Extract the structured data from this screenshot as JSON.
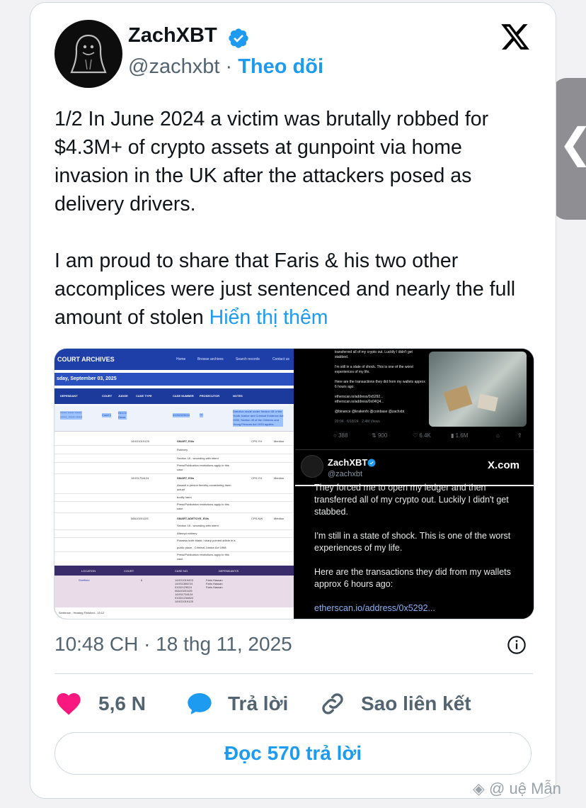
{
  "author": {
    "name": "ZachXBT",
    "handle": "@zachxbt",
    "separator": "·",
    "follow_label": "Theo dõi",
    "avatar_icon": "ghost-avatar-icon",
    "verified_icon": "verified-badge-icon"
  },
  "brand": {
    "logo_icon": "x-logo-icon"
  },
  "tweet": {
    "paragraph1": "1/2 In June 2024 a victim was brutally robbed for $4.3M+ of crypto assets at gunpoint via home invasion in the UK after the attackers posed as delivery drivers.",
    "paragraph2": "I am proud to share that Faris & his two other accomplices were just sentenced and nearly the full amount of stolen",
    "show_more": "Hiển thị thêm"
  },
  "media": {
    "court": {
      "title": "COURT ARCHIVES",
      "nav": [
        "Home",
        "Browse archives",
        "Search records",
        "Contact us"
      ],
      "date": "sday, September 03, 2025",
      "columns": [
        "DEFENDANT",
        "COURT",
        "JUDGE",
        "CASE TYPE",
        "CASE NUMBER",
        "PROSECUTOR",
        "NOTES"
      ],
      "row1": {
        "defendant": "****** ****** ******\n******, ****** ******",
        "court": "Court 1",
        "judge": "HHJ D\nDixon",
        "case_number": "01GD023024",
        "prosecutor": "***",
        "notes": "Direction made under Section 45 of the\nYouth Justice and Criminal Evidence Act\n1999, Section 49 of the Children and\nYoung Persons Act 1933 applies"
      },
      "cases": [
        {
          "case_no": "14XG1019125",
          "name": "SMART, Ellis",
          "prosecutor": "CPS-YH",
          "notes": "Mention",
          "lines": [
            "Robbery",
            "Section 18 - wounding with intent",
            "Press/Publication restrictions apply to this\ncase"
          ]
        },
        {
          "case_no": "14XS1734124",
          "name": "SMART, Ellis",
          "prosecutor": "CPS-YH",
          "notes": "Mention",
          "lines": [
            "Assault a person thereby occasioning them\nactual",
            "bodily harm",
            "Press/Publication restrictions apply to this\ncase"
          ]
        },
        {
          "case_no": "06A10201125",
          "name": "SMART-ADETOYE, Ellis",
          "prosecutor": "CPS-NW",
          "notes": "Mention",
          "lines": [
            "Section 18 - wounding with intent",
            "Attempt robbery",
            "Possess knife blade / sharp pointed article in a",
            "public place - Criminal Justice Act 1988",
            "Press/Publication restrictions apply to this\ncase"
          ]
        }
      ],
      "bottom_cols": [
        "LOCATION",
        "COURT",
        "CASE NO.",
        "DEFENDANT/S"
      ],
      "bottom_row": {
        "location": "Sheffield",
        "court": "6",
        "case_nos": "14XG1019423\n14XS1386724\n01GD123024\n06A10201125\n14XS1734124\n01GD1234824\n14XG1019125",
        "defendants": "Faris Hassan\nFaris Hassan\nFaris Hassan"
      },
      "footer": "Sentence - Hearing Finished - 15:12"
    },
    "tweet_top": {
      "text": "transferred all of my crypto out. Luckily I didn't get stabbed.\n\nI'm still in a state of shock. This is one of the worst experiences of my life.\n\nHere are the transactions they did from my wallets approx 6 hours ago:\n\netherscan.io/address/0x5292...\netherscan.io/address/0x04Q4...\n\n@binance @krakenfx @coinbase @zachxbt",
      "time": "20:04 · 6/18/24 · 2.4M Views",
      "stats": [
        "388",
        "900",
        "6.4K",
        "1.6M"
      ]
    },
    "tweet_card": {
      "name": "ZachXBT",
      "handle": "@zachxbt",
      "xcom": "X.com",
      "p1": "They forced me to open my ledger and then transferred all of my crypto out. Luckily I didn't get stabbed.",
      "p2": "I'm still in a state of shock. This is one of the worst experiences of my life.",
      "p3": "Here are the transactions they did from my wallets approx 6 hours ago:",
      "link": "etherscan.io/address/0x5292..."
    }
  },
  "meta": {
    "timestamp": "10:48 CH · 18 thg 11, 2025",
    "info_icon": "info-icon"
  },
  "actions": {
    "like_count": "5,6 N",
    "reply_label": "Trả lời",
    "copy_link_label": "Sao liên kết"
  },
  "read_replies_label": "Đọc 570 trả lời",
  "watermark": "@  uệ Mẫn",
  "colors": {
    "accent": "#1d9bf0",
    "like": "#f91880",
    "text": "#0f1419",
    "muted": "#536471"
  }
}
